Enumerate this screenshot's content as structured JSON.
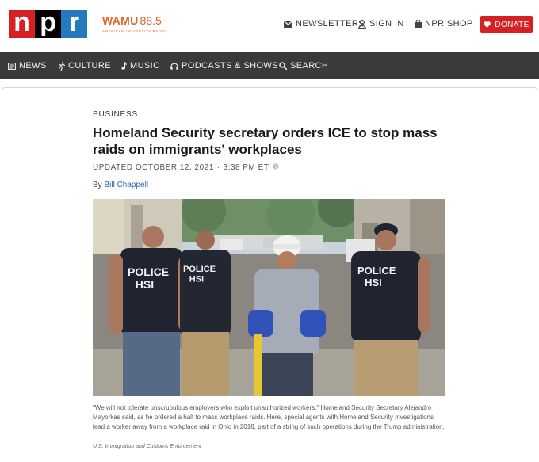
{
  "header": {
    "logo_letters": [
      "n",
      "p",
      "r"
    ],
    "station_call": "WAMU",
    "station_freq": "88.5",
    "station_sub": "AMERICAN UNIVERSITY RADIO",
    "newsletters": "NEWSLETTERS",
    "sign_in": "SIGN IN",
    "shop": "NPR SHOP",
    "donate": "DONATE",
    "colors": {
      "npr_red": "#d62021",
      "npr_black": "#000000",
      "npr_blue": "#237bbd",
      "wamu_orange": "#e0642a"
    }
  },
  "nav": {
    "items": [
      {
        "label": "NEWS",
        "icon": "news-icon"
      },
      {
        "label": "CULTURE",
        "icon": "culture-icon"
      },
      {
        "label": "MUSIC",
        "icon": "music-icon"
      },
      {
        "label": "PODCASTS & SHOWS",
        "icon": "headphones-icon"
      },
      {
        "label": "SEARCH",
        "icon": "search-icon"
      }
    ]
  },
  "article": {
    "slug": "BUSINESS",
    "headline": "Homeland Security secretary orders ICE to stop mass raids on immigrants' workplaces",
    "updated_label": "UPDATED OCTOBER 12, 2021",
    "separator": "·",
    "time": "3:38 PM ET",
    "byline_prefix": "By",
    "author": "Bill Chappell",
    "photo": {
      "vest_labels": [
        "POLICE HSI",
        "POLICE HSI",
        "POLICE HSI"
      ],
      "caption": "\"We will not tolerate unscrupulous employers who exploit unauthorized workers,\" Homeland Security Secretary Alejandro Mayorkas said, as he ordered a halt to mass workplace raids. Here, special agents with Homeland Security Investigations lead a worker away from a workplace raid in Ohio in 2018, part of a string of such operations during the Trump administration.",
      "credit": "U.S. Immigration and Customs Enforcement"
    }
  }
}
